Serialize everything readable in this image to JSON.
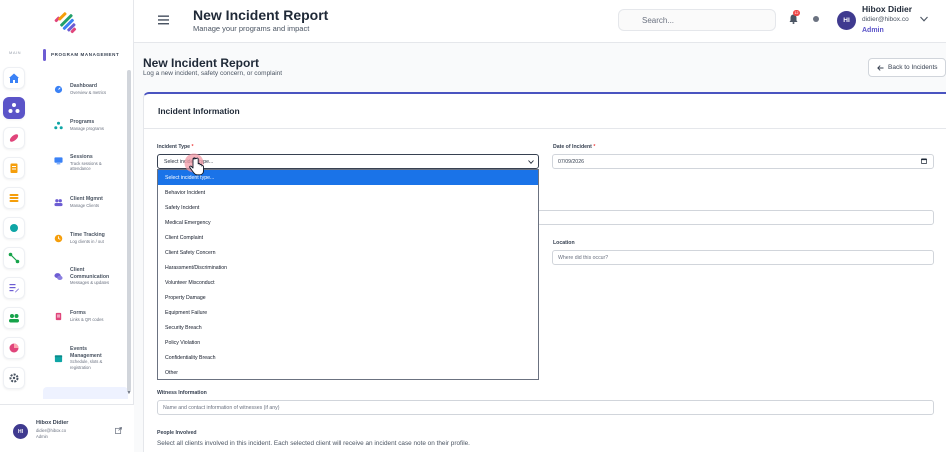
{
  "header": {
    "title": "New Incident Report",
    "subtitle": "Manage your programs and impact",
    "search_placeholder": "Search...",
    "notif_count": "12",
    "user": {
      "initials": "HI",
      "name": "Hibox Didier",
      "email": "didier@hibox.co",
      "role": "Admin"
    }
  },
  "sidebar": {
    "rail_label": "MAIN",
    "section_title": "PROGRAM MANAGEMENT",
    "items": [
      {
        "title": "Dashboard",
        "sub": "Overview & metrics"
      },
      {
        "title": "Programs",
        "sub": "Manage programs"
      },
      {
        "title": "Sessions",
        "sub": "Track sessions & attendance"
      },
      {
        "title": "Client Mgmnt",
        "sub": "Manage Clients"
      },
      {
        "title": "Time Tracking",
        "sub": "Log clients in / out"
      },
      {
        "title": "Client Communication",
        "sub": "Messages & updates"
      },
      {
        "title": "Forms",
        "sub": "Links & QR codes"
      },
      {
        "title": "Events Management",
        "sub": "Schedule, slots & registration"
      }
    ],
    "footer_user": {
      "initials": "HI",
      "name": "Hibox Didier",
      "email": "didier@hibox.co",
      "role": "Admin"
    }
  },
  "page": {
    "title": "New Incident Report",
    "subtitle": "Log a new incident, safety concern, or complaint",
    "back_label": "Back to Incidents"
  },
  "form": {
    "section_title": "Incident Information",
    "incident_type_label": "Incident Type",
    "incident_type_value": "Select incident type...",
    "date_label": "Date of Incident",
    "date_value": "07/09/2026",
    "location_label": "Location",
    "location_placeholder": "Where did this occur?",
    "witness_label": "Witness Information",
    "witness_placeholder": "Name and contact information of witnesses (if any)",
    "people_label": "People Involved",
    "people_help": "Select all clients involved in this incident. Each selected client will receive an incident case note on their profile.",
    "required_mark": "*"
  },
  "dropdown_options": [
    "Select incident type...",
    "Behavior Incident",
    "Safety Incident",
    "Medical Emergency",
    "Client Complaint",
    "Client Safety Concern",
    "Harassment/Discrimination",
    "Volunteer Misconduct",
    "Property Damage",
    "Equipment Failure",
    "Security Breach",
    "Policy Violation",
    "Confidentiality Breach",
    "Other"
  ],
  "colors": {
    "accent": "#5b54c8",
    "card_top": "#4a54c0",
    "selected_option": "#1a73e8"
  }
}
